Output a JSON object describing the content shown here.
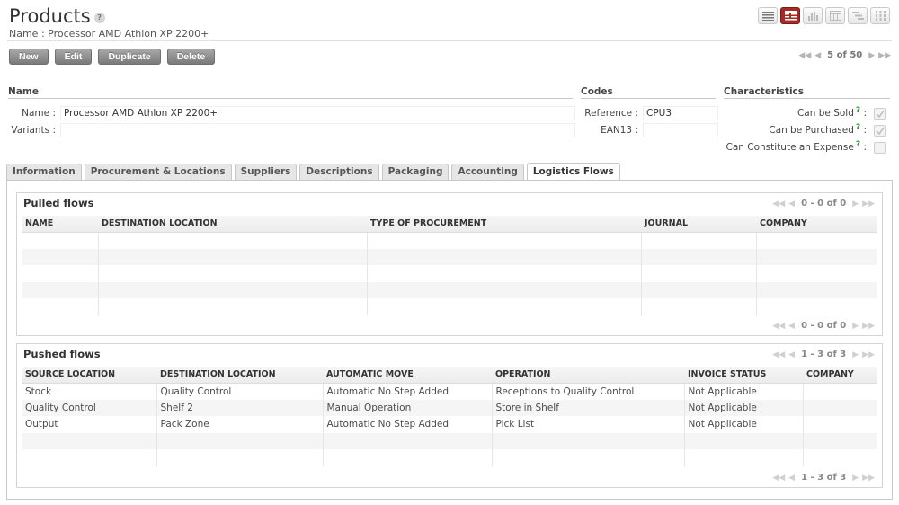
{
  "header": {
    "title": "Products",
    "help": "?",
    "subtitle": "Name : Processor AMD Athlon XP 2200+",
    "view_icons": [
      "list-icon",
      "form-icon",
      "graph-icon",
      "calendar-icon",
      "gantt-icon",
      "kanban-icon"
    ],
    "active_view": "form-icon"
  },
  "toolbar": {
    "new_label": "New",
    "edit_label": "Edit",
    "duplicate_label": "Duplicate",
    "delete_label": "Delete",
    "pager": "5 of 50"
  },
  "sections": {
    "name": "Name",
    "codes": "Codes",
    "characteristics": "Characteristics"
  },
  "fields": {
    "name_label": "Name :",
    "name_value": "Processor AMD Athlon XP 2200+",
    "variants_label": "Variants :",
    "variants_value": "",
    "reference_label": "Reference :",
    "reference_value": "CPU3",
    "ean13_label": "EAN13 :",
    "ean13_value": "",
    "can_be_sold_label": "Can be Sold",
    "can_be_purchased_label": "Can be Purchased",
    "can_constitute_expense_label": "Can Constitute an Expense",
    "help_mark": "?",
    "colon": ":",
    "can_be_sold": true,
    "can_be_purchased": true,
    "can_constitute_expense": false
  },
  "tabs": [
    {
      "label": "Information"
    },
    {
      "label": "Procurement & Locations"
    },
    {
      "label": "Suppliers"
    },
    {
      "label": "Descriptions"
    },
    {
      "label": "Packaging"
    },
    {
      "label": "Accounting"
    },
    {
      "label": "Logistics Flows"
    }
  ],
  "active_tab": "Logistics Flows",
  "pulled": {
    "title": "Pulled flows",
    "pager": "0 - 0 of 0",
    "columns": [
      "NAME",
      "DESTINATION LOCATION",
      "TYPE OF PROCUREMENT",
      "JOURNAL",
      "COMPANY"
    ],
    "rows": []
  },
  "pushed": {
    "title": "Pushed flows",
    "pager": "1 - 3 of 3",
    "columns": [
      "SOURCE LOCATION",
      "DESTINATION LOCATION",
      "AUTOMATIC MOVE",
      "OPERATION",
      "INVOICE STATUS",
      "COMPANY"
    ],
    "rows": [
      [
        "Stock",
        "Quality Control",
        "Automatic No Step Added",
        "Receptions to Quality Control",
        "Not Applicable",
        ""
      ],
      [
        "Quality Control",
        "Shelf 2",
        "Manual Operation",
        "Store in Shelf",
        "Not Applicable",
        ""
      ],
      [
        "Output",
        "Pack Zone",
        "Automatic No Step Added",
        "Pick List",
        "Not Applicable",
        ""
      ]
    ]
  }
}
